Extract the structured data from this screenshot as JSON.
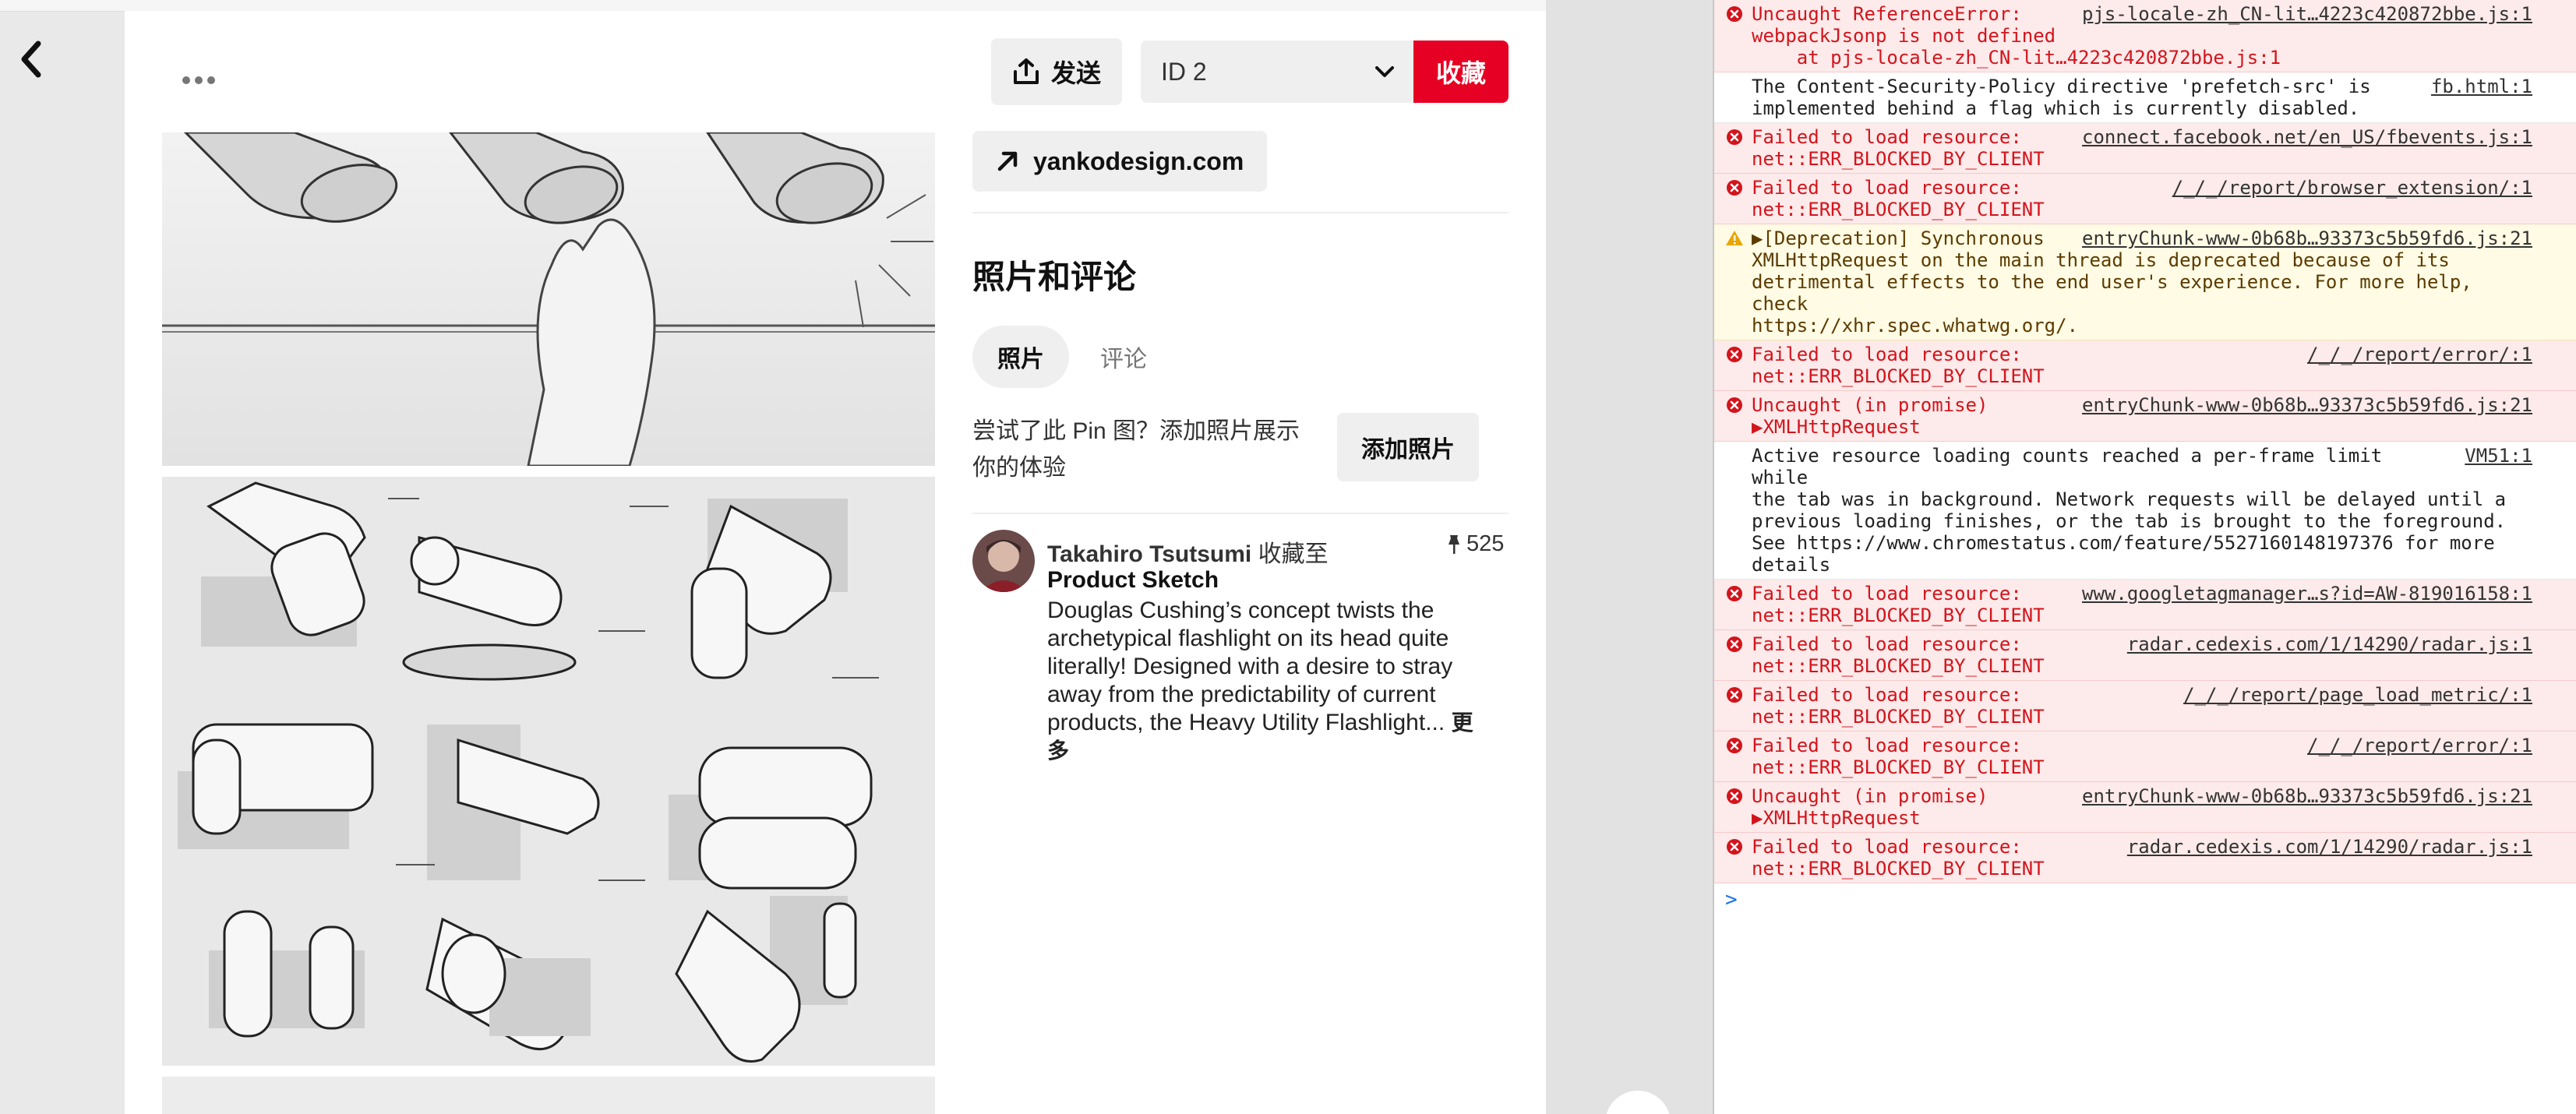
{
  "page": {
    "board_select_value": "ID 2",
    "send_label": "发送",
    "save_label": "收藏",
    "source_link": "yankodesign.com",
    "section_title": "照片和评论",
    "tabs": [
      {
        "label": "照片",
        "active": true
      },
      {
        "label": "评论",
        "active": false
      }
    ],
    "try_text": "尝试了此 Pin 图？添加照片展示你的体验",
    "add_photo_label": "添加照片",
    "author": {
      "name": "Takahiro Tsutsumi",
      "saved_to": "收藏至",
      "board": "Product Sketch",
      "save_count": "525"
    },
    "description": "Douglas Cushing’s concept twists the archetypical flashlight on its head quite literally! Designed with a desire to stray away from the predictability of current products, the Heavy Utility Flashlight...",
    "more_label": "更多",
    "colors": {
      "save_red": "#e60023",
      "button_gray": "#efefef"
    }
  },
  "console": {
    "messages": [
      {
        "level": "error",
        "lines": [
          "Uncaught ReferenceError:",
          "webpackJsonp is not defined",
          "    at pjs-locale-zh_CN-lit…4223c420872bbe.js:1"
        ],
        "source": "pjs-locale-zh_CN-lit…4223c420872bbe.js:1"
      },
      {
        "level": "info",
        "lines": [
          "The Content-Security-Policy directive 'prefetch-src' is",
          "implemented behind a flag which is currently disabled."
        ],
        "source": "fb.html:1"
      },
      {
        "level": "error",
        "lines": [
          "Failed to load resource:",
          "net::ERR_BLOCKED_BY_CLIENT"
        ],
        "source": "connect.facebook.net/en_US/fbevents.js:1"
      },
      {
        "level": "error",
        "lines": [
          "Failed to load resource:",
          "net::ERR_BLOCKED_BY_CLIENT"
        ],
        "source": "/_/_/report/browser_extension/:1"
      },
      {
        "level": "warning",
        "lines": [
          "▶[Deprecation] Synchronous",
          "XMLHttpRequest on the main thread is deprecated because of its",
          "detrimental effects to the end user's experience. For more help, check",
          "https://xhr.spec.whatwg.org/."
        ],
        "source": "entryChunk-www-0b68b…93373c5b59fd6.js:21"
      },
      {
        "level": "error",
        "lines": [
          "Failed to load resource:",
          "net::ERR_BLOCKED_BY_CLIENT"
        ],
        "source": "/_/_/report/error/:1"
      },
      {
        "level": "error",
        "lines": [
          "Uncaught (in promise)",
          "▶XMLHttpRequest"
        ],
        "source": "entryChunk-www-0b68b…93373c5b59fd6.js:21"
      },
      {
        "level": "info",
        "lines": [
          "Active resource loading counts reached a per-frame limit while",
          "the tab was in background. Network requests will be delayed until a",
          "previous loading finishes, or the tab is brought to the foreground.",
          "See https://www.chromestatus.com/feature/5527160148197376 for more",
          "details"
        ],
        "source": "VM51:1"
      },
      {
        "level": "error",
        "lines": [
          "Failed to load resource:",
          "net::ERR_BLOCKED_BY_CLIENT"
        ],
        "source": "www.googletagmanager…s?id=AW-819016158:1"
      },
      {
        "level": "error",
        "lines": [
          "Failed to load resource:",
          "net::ERR_BLOCKED_BY_CLIENT"
        ],
        "source": "radar.cedexis.com/1/14290/radar.js:1"
      },
      {
        "level": "error",
        "lines": [
          "Failed to load resource:",
          "net::ERR_BLOCKED_BY_CLIENT"
        ],
        "source": "/_/_/report/page_load_metric/:1"
      },
      {
        "level": "error",
        "lines": [
          "Failed to load resource:",
          "net::ERR_BLOCKED_BY_CLIENT"
        ],
        "source": "/_/_/report/error/:1"
      },
      {
        "level": "error",
        "lines": [
          "Uncaught (in promise)",
          "▶XMLHttpRequest"
        ],
        "source": "entryChunk-www-0b68b…93373c5b59fd6.js:21"
      },
      {
        "level": "error",
        "lines": [
          "Failed to load resource:",
          "net::ERR_BLOCKED_BY_CLIENT"
        ],
        "source": "radar.cedexis.com/1/14290/radar.js:1"
      }
    ],
    "prompt_symbol": ">"
  }
}
